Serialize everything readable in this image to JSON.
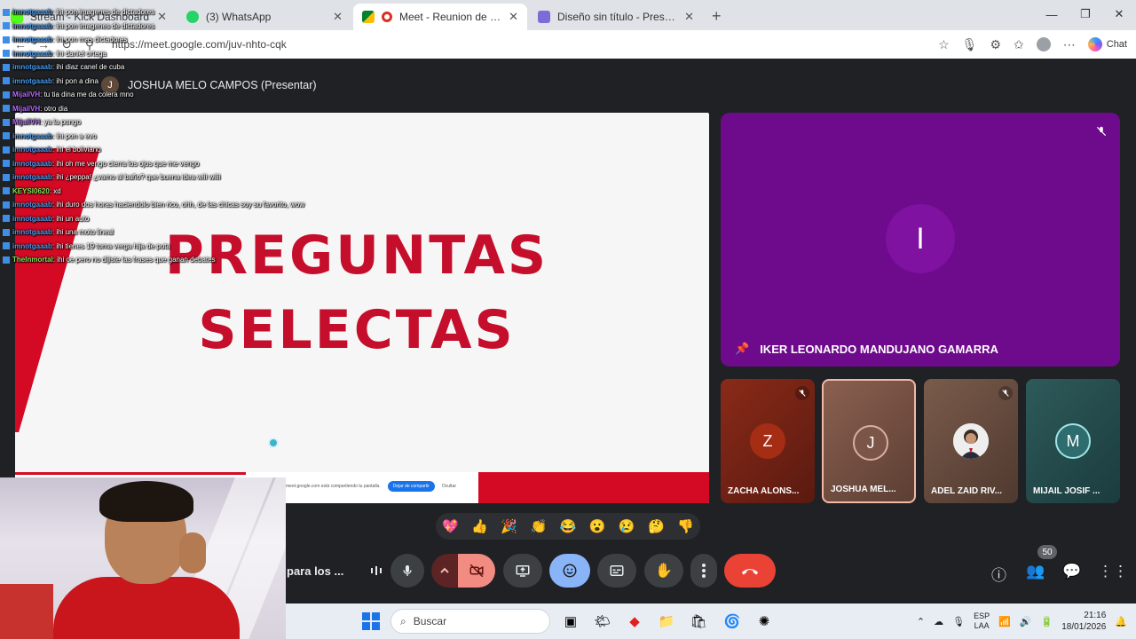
{
  "browser": {
    "tabs": [
      {
        "title": "Stream - Kick Dashboard",
        "active": false
      },
      {
        "title": "(3) WhatsApp",
        "active": false
      },
      {
        "title": "Meet - Reunion de presentaci",
        "active": true
      },
      {
        "title": "Diseño sin título - Presentación",
        "active": false
      }
    ],
    "url": "https://meet.google.com/juv-nhto-cqk",
    "chat_label": "Chat"
  },
  "meet": {
    "presenter_initial": "J",
    "presenter_label": "JOSHUA MELO CAMPOS (Presentar)",
    "slide": {
      "line1": "PREGUNTAS",
      "line2": "SELECTAS",
      "share_notice": "meet.google.com está compartiendo tu pantalla.",
      "stop_sharing": "Dejar de compartir",
      "hide": "Ocultar"
    },
    "pinned": {
      "initial": "I",
      "name": "IKER LEONARDO MANDUJANO GAMARRA"
    },
    "tiles": [
      {
        "initial": "Z",
        "name": "ZACHA ALONS..."
      },
      {
        "initial": "J",
        "name": "JOSHUA MEL..."
      },
      {
        "initial": "",
        "name": "ADEL ZAID RIV..."
      },
      {
        "initial": "M",
        "name": "MIJAIL JOSIF ..."
      }
    ],
    "reactions": [
      "💖",
      "👍",
      "🎉",
      "👏",
      "😂",
      "😮",
      "😢",
      "🤔",
      "👎"
    ],
    "meeting_name": "para los ...",
    "participant_count": "50"
  },
  "chat_overlay": [
    {
      "user": "imnotgaaab",
      "text": ": ihi pon imagenes de dictadores",
      "color": "#4a9cf0"
    },
    {
      "user": "imnotgaaab",
      "text": ": ihi pon imagenes de dictadores",
      "color": "#4a9cf0"
    },
    {
      "user": "imnotgaaab",
      "text": ": ihi pon mas dictadores",
      "color": "#4a9cf0"
    },
    {
      "user": "imnotgaaab",
      "text": ": ihi daniel ortega",
      "color": "#4a9cf0"
    },
    {
      "user": "imnotgaaab",
      "text": ": ihi diaz canel de cuba",
      "color": "#4a9cf0"
    },
    {
      "user": "imnotgaaab",
      "text": ": ihi pon a dina",
      "color": "#4a9cf0"
    },
    {
      "user": "MijailVH",
      "text": ": tu tia dina me da colera mno",
      "color": "#b86bff"
    },
    {
      "user": "MijailVH",
      "text": ": otro dia",
      "color": "#b86bff"
    },
    {
      "user": "MijailVH",
      "text": ": ya la pongo",
      "color": "#b86bff"
    },
    {
      "user": "imnotgaaab",
      "text": ": ihi pon a evo",
      "color": "#4a9cf0"
    },
    {
      "user": "imnotgaaab",
      "text": ": ihi el boliviano",
      "color": "#4a9cf0"
    },
    {
      "user": "imnotgaaab",
      "text": ": ihi oh me vengo cierra los ojos que me vengo",
      "color": "#4a9cf0"
    },
    {
      "user": "imnotgaaab",
      "text": ": ihi ¿peppa! ¿vamo al baño? que buena idea wiii wiiii",
      "color": "#4a9cf0"
    },
    {
      "user": "KEYSI0620",
      "text": ": xd",
      "color": "#7ee25a"
    },
    {
      "user": "imnotgaaab",
      "text": ": ihi duro dos horas haciendolo bien rico, ohh, de las chicas soy su favorito, wow",
      "color": "#4a9cf0"
    },
    {
      "user": "imnotgaaab",
      "text": ": ihi un auto",
      "color": "#4a9cf0"
    },
    {
      "user": "imnotgaaab",
      "text": ": ihi una moto lineal",
      "color": "#4a9cf0"
    },
    {
      "user": "imnotgaaab",
      "text": ": ihi tienes 19 toma verga hija de puta",
      "color": "#4a9cf0"
    },
    {
      "user": "TheInmortal",
      "text": ": ihi oe pero no dijiste las frases que ganan debates",
      "color": "#7ee25a"
    }
  ],
  "taskbar": {
    "search_placeholder": "Buscar",
    "lang_top": "ESP",
    "lang_bottom": "LAA",
    "time": "21:16",
    "date": "18/01/2026"
  }
}
